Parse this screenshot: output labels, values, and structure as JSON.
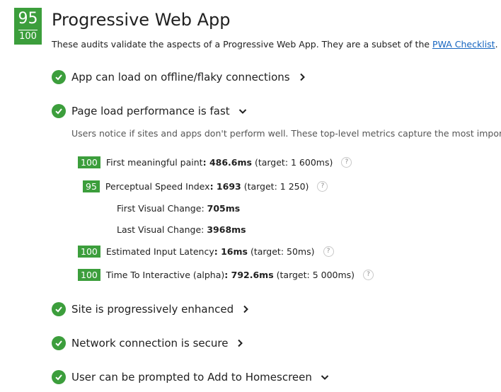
{
  "category": {
    "score": "95",
    "score_total": "100",
    "title": "Progressive Web App",
    "description_prefix": "These audits validate the aspects of a Progressive Web App. They are a subset of the ",
    "description_link": "PWA Checklist",
    "description_suffix": "."
  },
  "audits": [
    {
      "label": "App can load on offline/flaky connections",
      "expanded": false
    },
    {
      "label": "Page load performance is fast",
      "expanded": true
    },
    {
      "label": "Site is progressively enhanced",
      "expanded": false
    },
    {
      "label": "Network connection is secure",
      "expanded": false
    },
    {
      "label": "User can be prompted to Add to Homescreen",
      "expanded": true
    }
  ],
  "perf_description": "Users notice if sites and apps don't perform well. These top-level metrics capture the most importa",
  "metrics": [
    {
      "score": "100",
      "name": "First meaningful paint",
      "value": "486.6ms",
      "target": "(target: 1 600ms)"
    },
    {
      "score": "95",
      "name": "Perceptual Speed Index",
      "value": "1693",
      "target": "(target: 1 250)"
    },
    {
      "score": "100",
      "name": "Estimated Input Latency",
      "value": "16ms",
      "target": "(target: 50ms)"
    },
    {
      "score": "100",
      "name": "Time To Interactive (alpha)",
      "value": "792.6ms",
      "target": "(target: 5 000ms)"
    }
  ],
  "sub_metrics": [
    {
      "name": "First Visual Change",
      "value": "705ms"
    },
    {
      "name": "Last Visual Change",
      "value": "3968ms"
    }
  ],
  "help_glyph": "?",
  "colors": {
    "pass_green": "#3c9e3c",
    "link_blue": "#1565c0"
  }
}
